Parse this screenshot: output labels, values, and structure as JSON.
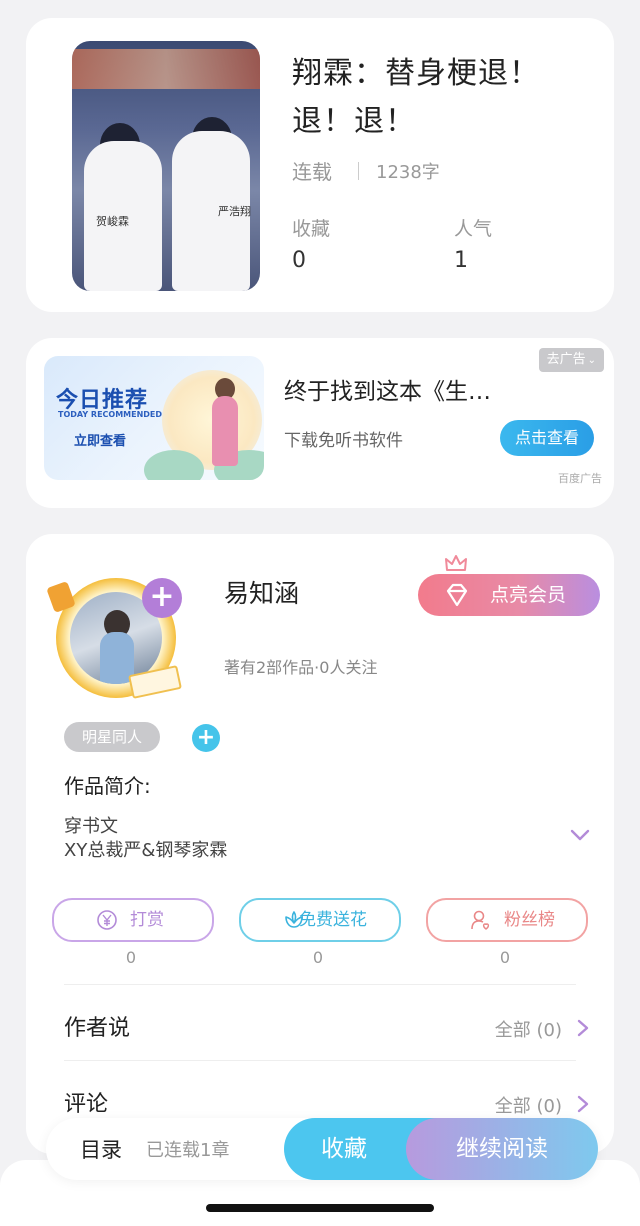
{
  "book": {
    "cover": {
      "name_left": "贺峻霖",
      "name_right": "严浩翔"
    },
    "title": "翔霖：替身梗退！退！退！",
    "status": "连载",
    "word_count": "1238字",
    "stats": [
      {
        "label": "收藏",
        "value": "0"
      },
      {
        "label": "人气",
        "value": "1"
      }
    ]
  },
  "ad": {
    "image": {
      "title": "今日推荐",
      "subtitle": "TODAY RECOMMENDED",
      "cta": "立即查看"
    },
    "title": "终于找到这本《生…",
    "subtitle": "下载免听书软件",
    "button": "点击查看",
    "close_label": "去广告",
    "source": "百度广告"
  },
  "author": {
    "name": "易知涵",
    "meta": "著有2部作品·0人关注",
    "vip_label": "点亮会员",
    "tag": "明星同人",
    "intro_label": "作品简介:",
    "intro_lines": [
      "穿书文",
      "XY总裁严&钢琴家霖"
    ],
    "actions": [
      {
        "label": "打赏",
        "count": "0",
        "icon": "yen-coin-icon"
      },
      {
        "label": "免费送花",
        "count": "0",
        "icon": "flower-icon"
      },
      {
        "label": "粉丝榜",
        "count": "0",
        "icon": "fan-user-icon"
      }
    ],
    "sections": [
      {
        "title": "作者说",
        "right": "全部 (0)"
      },
      {
        "title": "评论",
        "right": "全部 (0)"
      }
    ]
  },
  "bottom_bar": {
    "toc_label": "目录",
    "toc_status": "已连载1章",
    "collect_button": "收藏",
    "read_button": "继续阅读"
  },
  "colors": {
    "background": "#f2f2f4",
    "accent_blue": "#4cc6ef",
    "accent_purple": "#b37ed8",
    "vip_pink": "#f27b8c"
  }
}
